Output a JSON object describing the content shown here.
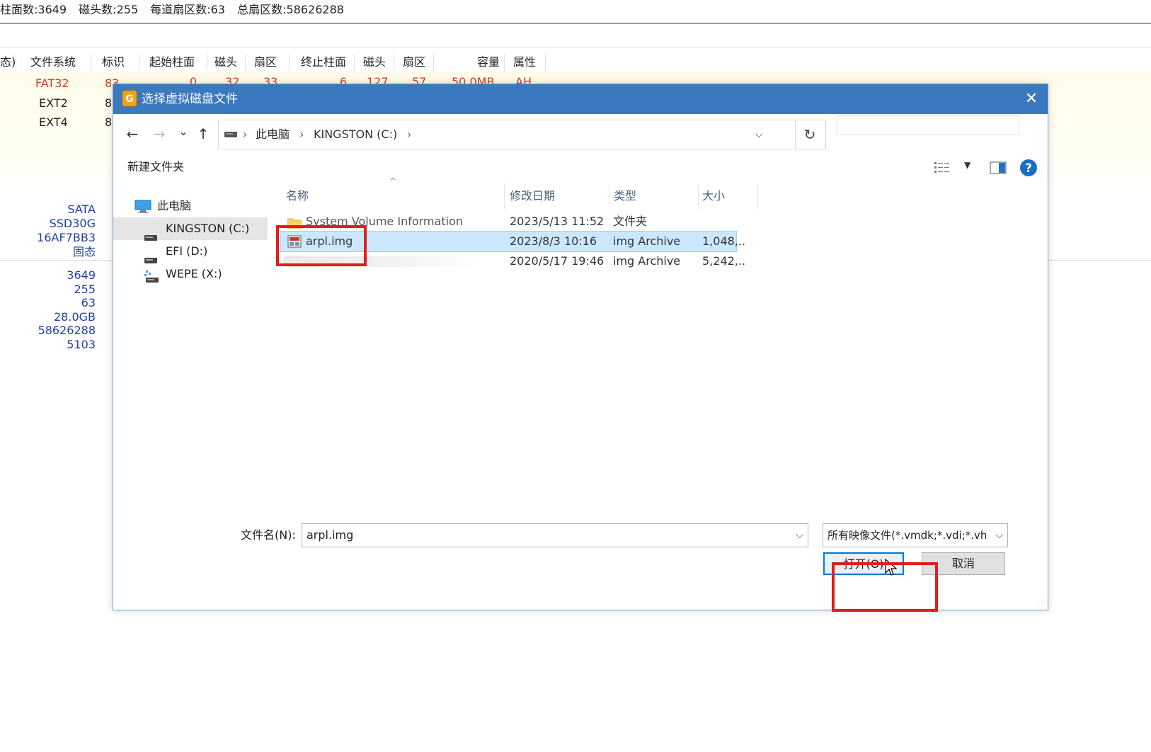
{
  "background_app": {
    "status_items": [
      "柱面数:3649",
      "磁头数:255",
      "每道扇区数:63",
      "总扇区数:58626288"
    ],
    "columns": [
      "态)",
      "文件系统",
      "标识",
      "起始柱面",
      "磁头",
      "扇区",
      "终止柱面",
      "磁头",
      "扇区",
      "容量",
      "属性"
    ],
    "partitions": [
      {
        "fs": "FAT32",
        "id": "83",
        "start_cyl": "0",
        "start_head": "32",
        "start_sector": "33",
        "end_cyl": "6",
        "end_head": "127",
        "end_sector": "57",
        "capacity": "50.0MB",
        "attr": "AH"
      },
      {
        "fs": "EXT2",
        "id": "8"
      },
      {
        "fs": "EXT4",
        "id": "8"
      }
    ],
    "disk_info": [
      "SATA",
      "SSD30G",
      "16AF7BB3",
      "固态"
    ],
    "disk_stats": [
      "3649",
      "255",
      "63",
      "28.0GB",
      "58626288",
      "5103"
    ],
    "colors": {
      "fat32": "#d23c2a",
      "info_text": "#1e3fa8"
    }
  },
  "dialog": {
    "title": "选择虚拟磁盘文件",
    "title_icon": "app-logo-icon",
    "close_glyph": "✕",
    "nav": {
      "back": "←",
      "forward": "→",
      "recent": "⌄",
      "up": "↑"
    },
    "breadcrumb": [
      "此电脑",
      "KINGSTON (C:)"
    ],
    "refresh_glyph": "↻",
    "new_folder": "新建文件夹",
    "sidebar": [
      {
        "label": "此电脑",
        "icon": "computer-icon"
      },
      {
        "label": "KINGSTON (C:)",
        "icon": "drive-icon",
        "selected": true
      },
      {
        "label": "EFI (D:)",
        "icon": "drive-icon"
      },
      {
        "label": "WEPE (X:)",
        "icon": "network-drive-icon"
      }
    ],
    "columns": {
      "name": "名称",
      "modified": "修改日期",
      "type": "类型",
      "size": "大小"
    },
    "files": [
      {
        "name": "System Volume Information",
        "modified": "2023/5/13 11:52",
        "type": "文件夹",
        "size": ""
      },
      {
        "name": "arpl.img",
        "modified": "2023/8/3 10:16",
        "type": "img Archive",
        "size": "1,048,...",
        "selected": true
      },
      {
        "name": "",
        "modified": "2020/5/17 19:46",
        "type": "img Archive",
        "size": "5,242,..."
      }
    ],
    "filename_label": "文件名(N):",
    "filename_value": "arpl.img",
    "filter_value": "所有映像文件(*.vmdk;*.vdi;*.vh",
    "open_button": "打开(O)",
    "cancel_button": "取消",
    "accent": "#0078d7",
    "titlebar_color": "#3a78c0",
    "highlight_color": "#e01e1e"
  }
}
